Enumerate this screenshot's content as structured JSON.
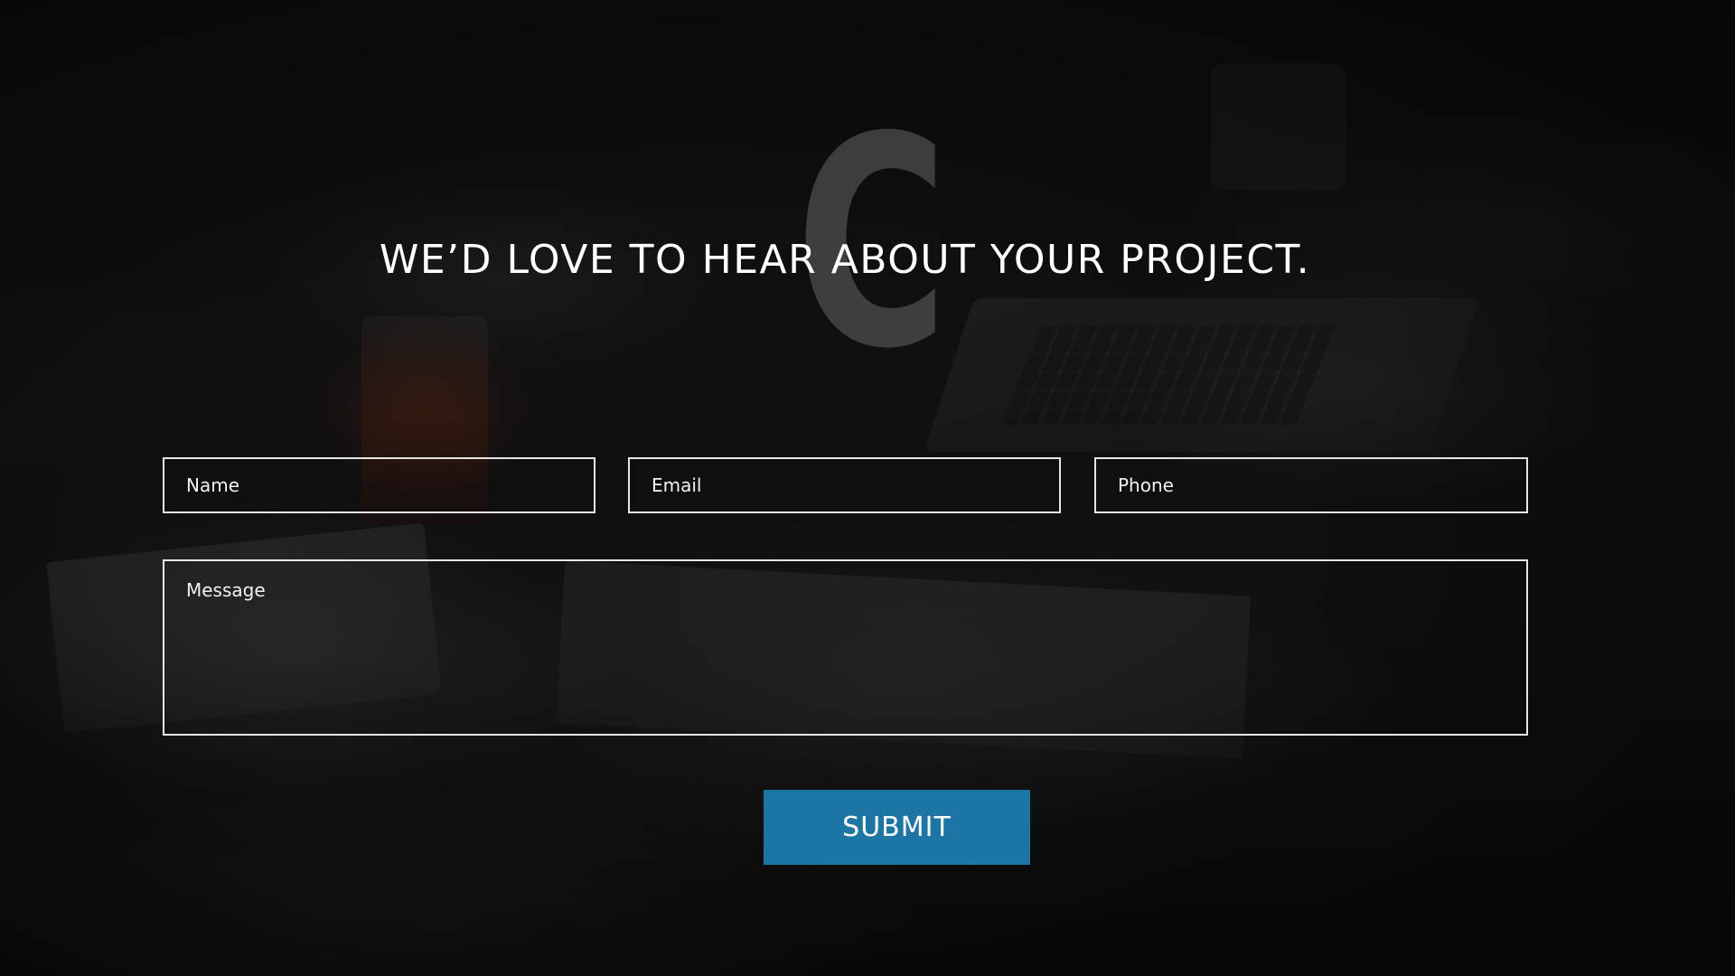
{
  "page": {
    "heading": "WE’D LOVE TO HEAR ABOUT YOUR PROJECT.",
    "watermark_letter": "C"
  },
  "form": {
    "name": {
      "placeholder": "Name",
      "value": ""
    },
    "email": {
      "placeholder": "Email",
      "value": ""
    },
    "phone": {
      "placeholder": "Phone",
      "value": ""
    },
    "message": {
      "placeholder": "Message",
      "value": ""
    },
    "submit_label": "SUBMIT"
  },
  "colors": {
    "accent": "#1b76a6",
    "field_border": "#e6e6e6",
    "overlay": "#08080a"
  }
}
